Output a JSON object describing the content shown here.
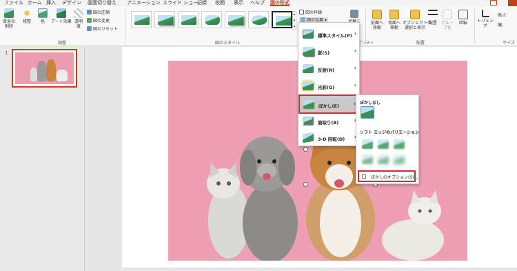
{
  "menu": {
    "tabs": [
      "ファイル",
      "ホーム",
      "挿入",
      "デザイン",
      "画面切り替え",
      "アニメーション",
      "スライド ショー",
      "記録",
      "校閲",
      "表示",
      "ヘルプ",
      "図の形式"
    ],
    "active_tab": "図の形式"
  },
  "ribbon": {
    "adjust": {
      "remove_background": "背景の\n削除",
      "corrections": "修整",
      "color": "色",
      "artistic_effects": "アート効果",
      "transparency": "透明\n度",
      "compress": "図の圧縮",
      "change_picture": "図の変更",
      "reset_picture": "図のリセット",
      "group_label": "調整"
    },
    "styles": {
      "group_label": "図のスタイル"
    },
    "picture_border": "図の枠線",
    "picture_effects": "図の効果",
    "alt_text": "代替テ",
    "accessibility_label": "ビリティ",
    "arrange": {
      "bring_forward": "前面へ\n移動",
      "send_backward": "背面へ\n移動",
      "selection_pane": "オブジェクトの\n選択と表示",
      "align": "配置",
      "group": "グループ化",
      "rotate": "回転",
      "group_label": "配置"
    },
    "size": {
      "crop": "トリミング",
      "height_label": "高さ:",
      "width_label": "幅:",
      "group_label": "サイズ"
    },
    "accent_color": "#c43e1c"
  },
  "slides_pane": {
    "slide_number": "1"
  },
  "effects_menu": {
    "items": [
      {
        "label": "標準スタイル(P)",
        "icon": "preset-icon"
      },
      {
        "label": "影(S)",
        "icon": "shadow-icon"
      },
      {
        "label": "反射(R)",
        "icon": "reflection-icon"
      },
      {
        "label": "光彩(G)",
        "icon": "glow-icon"
      },
      {
        "label": "ぼかし(E)",
        "icon": "soft-edges-icon"
      },
      {
        "label": "面取り(B)",
        "icon": "bevel-icon"
      },
      {
        "label": "3-D 回転(D)",
        "icon": "3d-rotation-icon"
      }
    ],
    "highlighted": "ぼかし(E)",
    "submenu_arrow": "›"
  },
  "soft_edges_submenu": {
    "no_soft_edges": "ぼかしなし",
    "variations_header": "ソフト エッジのバリエーション",
    "options_label": "ぼかしのオプション(S)..."
  },
  "highlight_color": "#d62b35"
}
